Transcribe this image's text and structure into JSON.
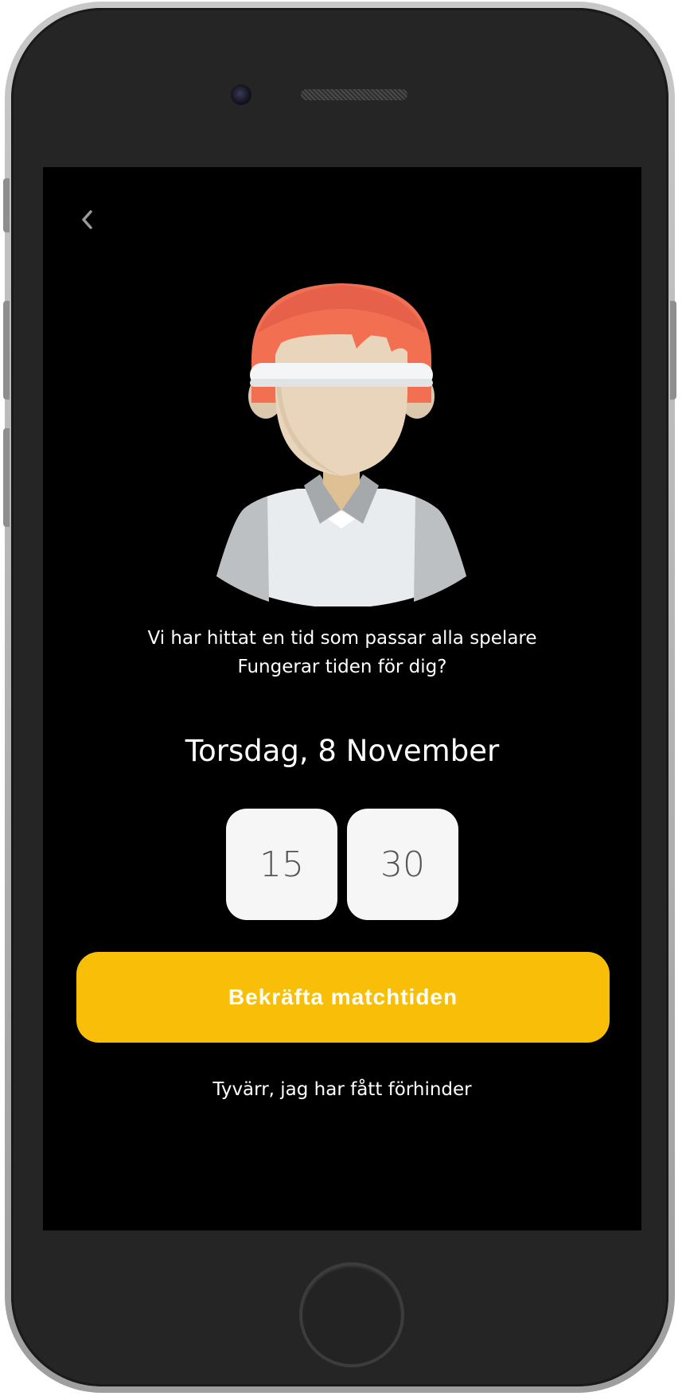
{
  "colors": {
    "screen_background": "#000000",
    "accent": "#f9bf08",
    "time_box_background": "#f6f6f6",
    "text_primary": "#ffffff",
    "time_text": "#555555"
  },
  "header": {
    "back_icon": "chevron-left-icon"
  },
  "avatar": {
    "icon": "player-avatar-illustration"
  },
  "message": {
    "line1": "Vi har hittat en tid som passar alla spelare",
    "line2": "Fungerar tiden för dig?"
  },
  "match": {
    "date": "Torsdag, 8 November",
    "hour": "15",
    "minute": "30"
  },
  "actions": {
    "confirm_label": "Bekräfta matchtiden",
    "decline_label": "Tyvärr, jag har fått förhinder"
  }
}
